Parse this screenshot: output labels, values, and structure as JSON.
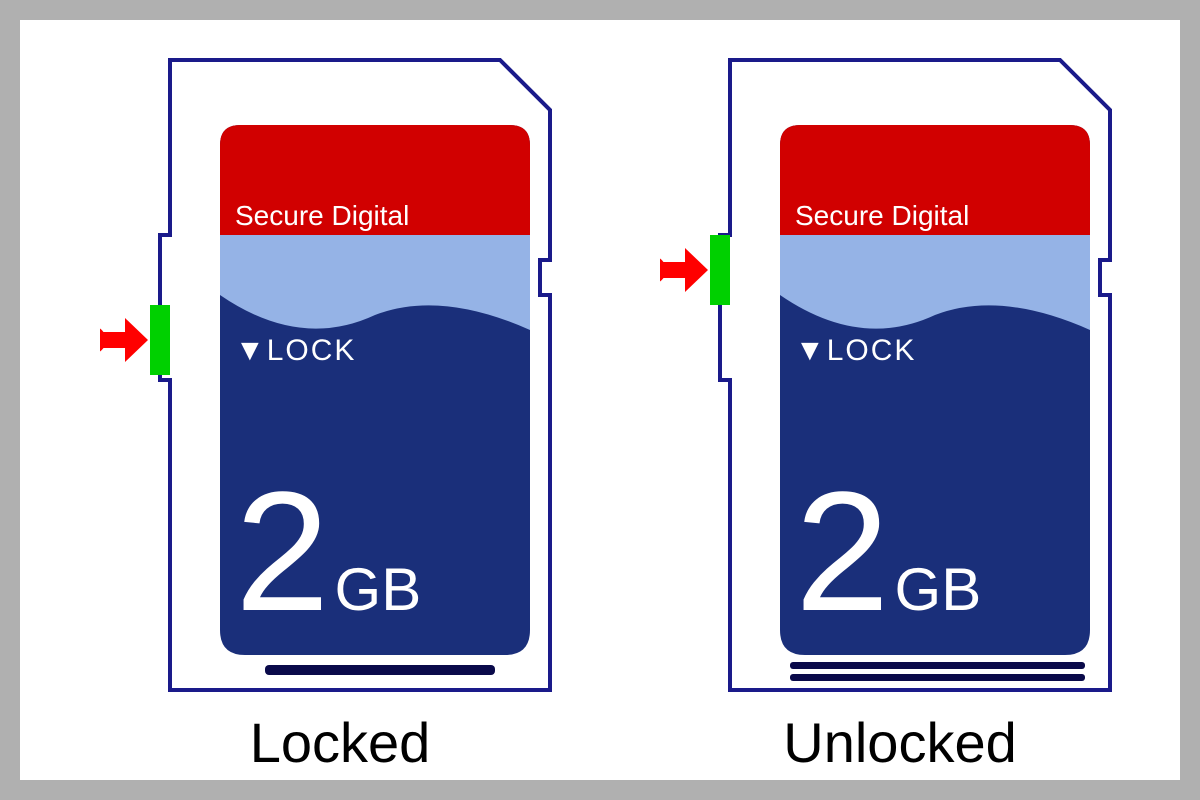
{
  "cards": {
    "brand": "Secure Digital",
    "lock_label": "LOCK",
    "capacity_number": "2",
    "capacity_unit": "GB",
    "locked_caption": "Locked",
    "unlocked_caption": "Unlocked"
  },
  "colors": {
    "outline": "#1a1a8a",
    "red_band": "#d10000",
    "light_blue": "#95b3e6",
    "dark_blue": "#1a2f7a",
    "switch": "#00d000",
    "arrow": "#ff0000",
    "text_white": "#ffffff",
    "caption": "#000000"
  }
}
